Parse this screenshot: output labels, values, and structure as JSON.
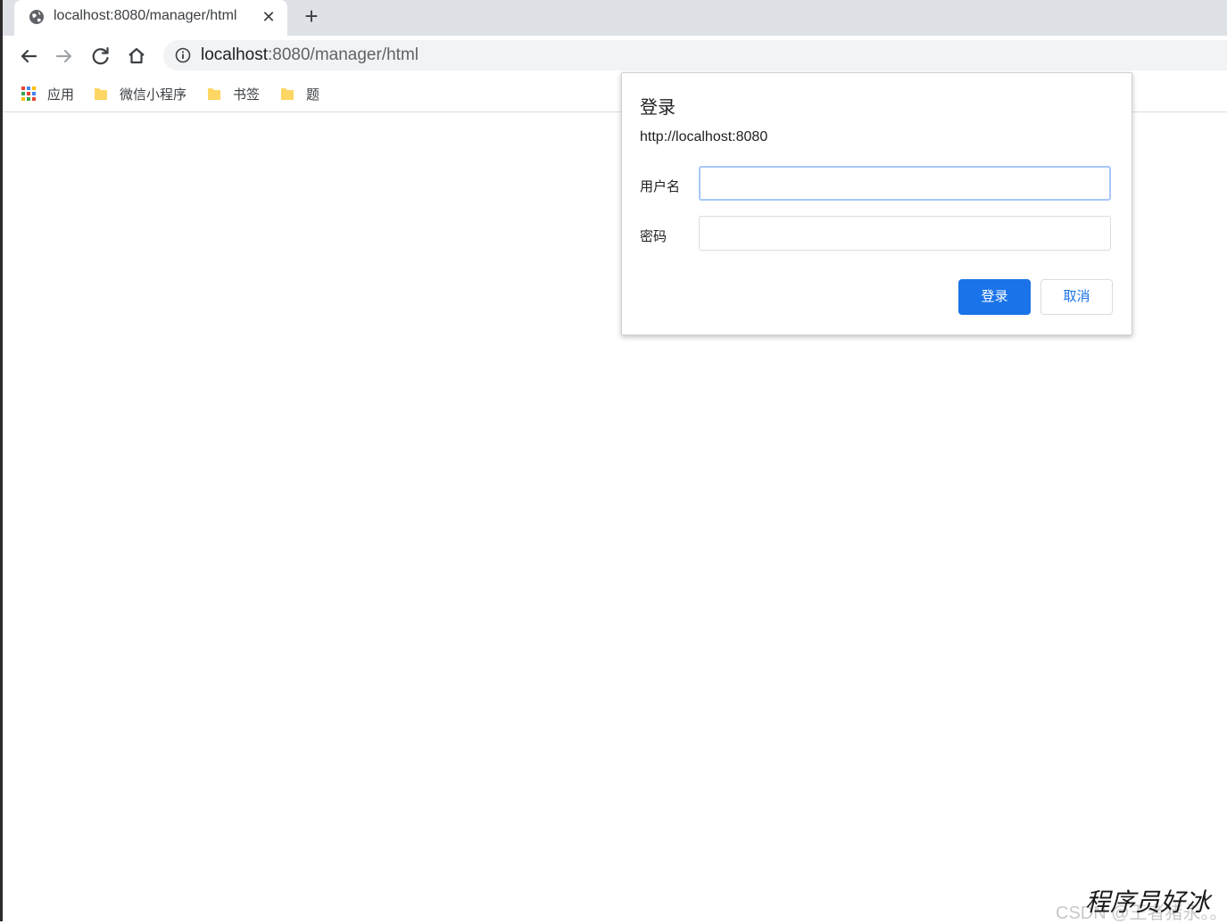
{
  "browser": {
    "tab": {
      "title": "localhost:8080/manager/html",
      "favicon_icon": "globe-icon",
      "close_glyph": "✕"
    },
    "new_tab_glyph": "+",
    "toolbar": {
      "back_icon": "back-arrow-icon",
      "forward_icon": "forward-arrow-icon",
      "reload_icon": "reload-icon",
      "home_icon": "home-icon"
    },
    "omnibox": {
      "info_icon": "info-icon",
      "url_host": "localhost",
      "url_rest": ":8080/manager/html"
    },
    "bookmarks": [
      {
        "label": "应用",
        "icon": "apps-grid-icon"
      },
      {
        "label": "微信小程序",
        "icon": "folder-icon"
      },
      {
        "label": "书签",
        "icon": "folder-icon"
      },
      {
        "label": "题",
        "icon": "folder-icon"
      }
    ]
  },
  "dialog": {
    "title": "登录",
    "origin": "http://localhost:8080",
    "username_label": "用户名",
    "username_value": "",
    "password_label": "密码",
    "password_value": "",
    "login_button": "登录",
    "cancel_button": "取消"
  },
  "watermark": {
    "csdn": "CSDN @王者猪永。。",
    "author": "程序员好冰"
  },
  "colors": {
    "tabstrip": "#dee1e6",
    "omnibox": "#f1f3f4",
    "primary": "#1a73e8",
    "focus_ring": "#a8c7fa"
  }
}
